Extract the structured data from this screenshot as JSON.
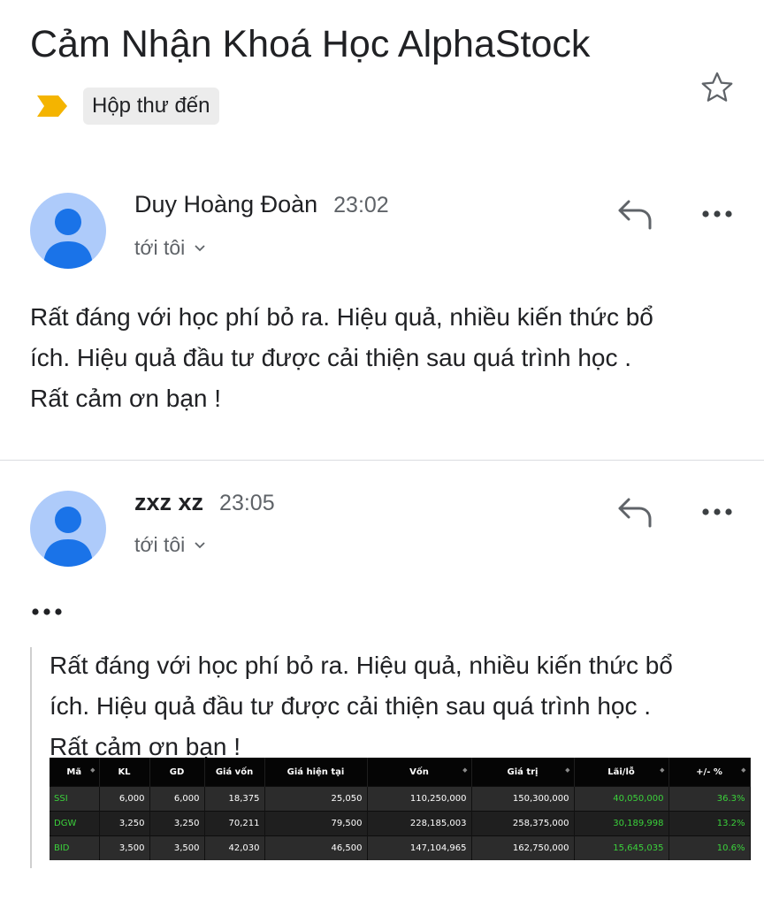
{
  "email": {
    "subject": "Cảm Nhận Khoá Học AlphaStock",
    "label": "Hộp thư đến",
    "label_color": "#f4b400",
    "star_icon": "star-outline-icon"
  },
  "messages": [
    {
      "sender": "Duy Hoàng Đoàn",
      "time": "23:02",
      "recipient": "tới tôi",
      "body_lines": [
        "Rất đáng với học phí bỏ ra. Hiệu quả, nhiều kiến thức bổ",
        "ích. Hiệu quả đầu tư được cải thiện sau quá trình học .",
        "Rất cảm ơn bạn !"
      ]
    },
    {
      "sender": "zxz xz",
      "time": "23:05",
      "recipient": "tới tôi",
      "trimmed_indicator": "•••",
      "quoted_lines": [
        "Rất đáng với học phí bỏ ra. Hiệu quả, nhiều kiến thức bổ",
        "ích. Hiệu quả đầu tư được cải thiện sau quá trình học .",
        "Rất cảm ơn bạn !"
      ]
    }
  ],
  "portfolio_table": {
    "columns": [
      "Mã",
      "KL",
      "GD",
      "Giá vốn",
      "Giá hiện tại",
      "Vốn",
      "Giá trị",
      "Lãi/lỗ",
      "+/- %"
    ],
    "rows": [
      [
        "SSI",
        "6,000",
        "6,000",
        "18,375",
        "25,050",
        "110,250,000",
        "150,300,000",
        "40,050,000",
        "36.3%"
      ],
      [
        "DGW",
        "3,250",
        "3,250",
        "70,211",
        "79,500",
        "228,185,003",
        "258,375,000",
        "30,189,998",
        "13.2%"
      ],
      [
        "BID",
        "3,500",
        "3,500",
        "42,030",
        "46,500",
        "147,104,965",
        "162,750,000",
        "15,645,035",
        "10.6%"
      ]
    ],
    "gain_color": "#3bd13b"
  }
}
